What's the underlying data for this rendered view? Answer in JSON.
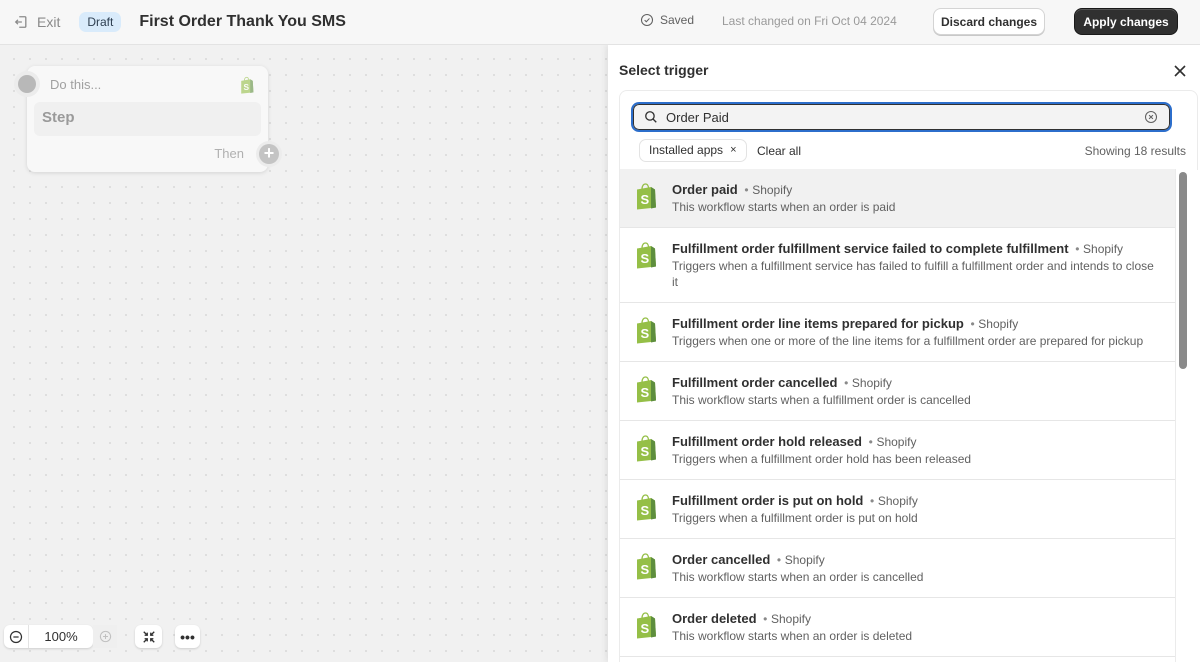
{
  "topbar": {
    "exit_label": "Exit",
    "status_badge": "Draft",
    "workflow_title": "First Order Thank You SMS",
    "saved_label": "Saved",
    "last_changed": "Last changed on Fri Oct 04 2024",
    "discard_label": "Discard changes",
    "apply_label": "Apply changes"
  },
  "canvas": {
    "step_card": {
      "header": "Do this...",
      "step_label": "Step",
      "then_label": "Then"
    },
    "zoom_level": "100%"
  },
  "panel": {
    "title": "Select trigger",
    "search": {
      "value": "Order Paid",
      "placeholder": "Search"
    },
    "filter_chip": "Installed apps",
    "filter_chip_remove": "×",
    "clear_all": "Clear all",
    "result_count": "Showing 18 results",
    "items": [
      {
        "name": "Order paid",
        "source": "Shopify",
        "description": "This workflow starts when an order is paid",
        "selected": true
      },
      {
        "name": "Fulfillment order fulfillment service failed to complete fulfillment",
        "source": "Shopify",
        "description": "Triggers when a fulfillment service has failed to fulfill a fulfillment order and intends to close it"
      },
      {
        "name": "Fulfillment order line items prepared for pickup",
        "source": "Shopify",
        "description": "Triggers when one or more of the line items for a fulfillment order are prepared for pickup"
      },
      {
        "name": "Fulfillment order cancelled",
        "source": "Shopify",
        "description": "This workflow starts when a fulfillment order is cancelled"
      },
      {
        "name": "Fulfillment order hold released",
        "source": "Shopify",
        "description": "Triggers when a fulfillment order hold has been released"
      },
      {
        "name": "Fulfillment order is put on hold",
        "source": "Shopify",
        "description": "Triggers when a fulfillment order is put on hold"
      },
      {
        "name": "Order cancelled",
        "source": "Shopify",
        "description": "This workflow starts when an order is cancelled"
      },
      {
        "name": "Order deleted",
        "source": "Shopify",
        "description": "This workflow starts when an order is deleted"
      }
    ],
    "separator": "•"
  },
  "colors": {
    "shopify_green": "#95bf47",
    "shopify_dark_green": "#5e8e3e",
    "focus_blue": "#2c6ecb",
    "primary_button": "#303030",
    "draft_badge": "#d9ebfb"
  }
}
